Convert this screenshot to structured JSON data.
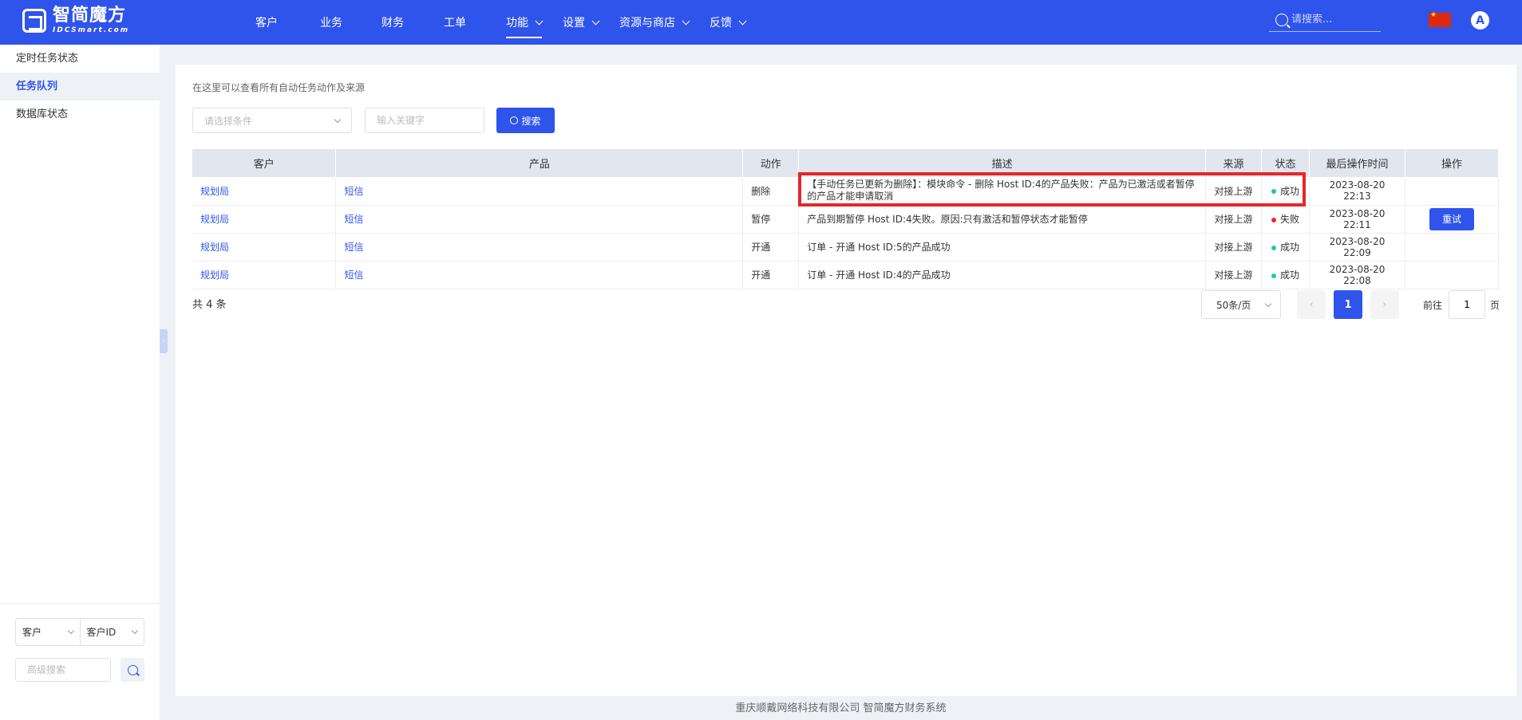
{
  "brand": {
    "name_cn": "智简魔方",
    "name_en": "IDCSmart.com"
  },
  "nav": {
    "items": [
      {
        "label": "客户",
        "dropdown": false,
        "active": false
      },
      {
        "label": "业务",
        "dropdown": false,
        "active": false
      },
      {
        "label": "财务",
        "dropdown": false,
        "active": false
      },
      {
        "label": "工单",
        "dropdown": false,
        "active": false
      },
      {
        "label": "功能",
        "dropdown": true,
        "active": true
      },
      {
        "label": "设置",
        "dropdown": true,
        "active": false
      },
      {
        "label": "资源与商店",
        "dropdown": true,
        "active": false
      },
      {
        "label": "反馈",
        "dropdown": true,
        "active": false
      }
    ],
    "search_placeholder": "请搜索...",
    "avatar_letter": "A"
  },
  "sidebar": {
    "items": [
      {
        "label": "定时任务状态",
        "active": false
      },
      {
        "label": "任务队列",
        "active": true
      },
      {
        "label": "数据库状态",
        "active": false
      }
    ],
    "select_1": "客户",
    "select_2": "客户ID",
    "adv_search_placeholder": "高级搜索"
  },
  "main": {
    "hint": "在这里可以查看所有自动任务动作及来源",
    "condition_placeholder": "请选择条件",
    "keyword_placeholder": "输入关键字",
    "search_label": "搜索",
    "columns": [
      "客户",
      "产品",
      "动作",
      "描述",
      "来源",
      "状态",
      "最后操作时间",
      "操作"
    ],
    "rows": [
      {
        "client": "规划局",
        "product": "短信",
        "action": "删除",
        "desc": "【手动任务已更新为删除】：模块命令 - 删除 Host ID:4的产品失败：产品为已激活或者暂停的产品才能申请取消",
        "source": "对接上游",
        "status": "成功",
        "status_color": "#1ec8a5",
        "time": "2023-08-20 22:13",
        "op": ""
      },
      {
        "client": "规划局",
        "product": "短信",
        "action": "暂停",
        "desc": "产品到期暂停 Host ID:4失败。原因:只有激活和暂停状态才能暂停",
        "source": "对接上游",
        "status": "失败",
        "status_color": "#f5222d",
        "time": "2023-08-20 22:11",
        "op": "重试"
      },
      {
        "client": "规划局",
        "product": "短信",
        "action": "开通",
        "desc": "订单 - 开通 Host ID:5的产品成功",
        "source": "对接上游",
        "status": "成功",
        "status_color": "#1ec8a5",
        "time": "2023-08-20 22:09",
        "op": ""
      },
      {
        "client": "规划局",
        "product": "短信",
        "action": "开通",
        "desc": "订单 - 开通 Host ID:4的产品成功",
        "source": "对接上游",
        "status": "成功",
        "status_color": "#1ec8a5",
        "time": "2023-08-20 22:08",
        "op": ""
      }
    ],
    "total": "共 4 条",
    "page_size": "50条/页",
    "current_page": "1",
    "goto_prefix": "前往",
    "goto_value": "1",
    "goto_suffix": "页"
  },
  "footer": "重庆顺戴网络科技有限公司 智简魔方财务系统",
  "colors": {
    "accent": "#2f54eb",
    "highlight": "#e5262d"
  }
}
